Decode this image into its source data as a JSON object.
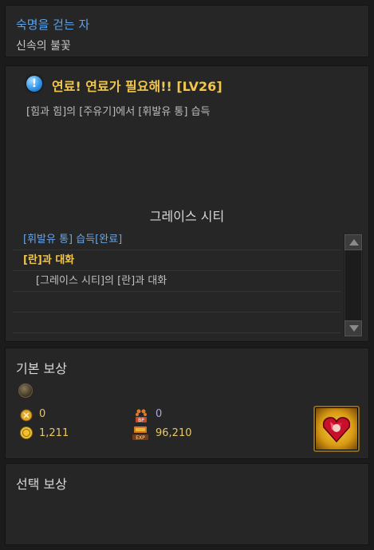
{
  "header": {
    "title": "숙명을 걷는 자",
    "subtitle": "신속의 불꽃"
  },
  "quest": {
    "title": "연료! 연료가 필요해!! [LV26]",
    "description": "[힘과 힘]의 [주유기]에서 [휘발유 통] 습득",
    "location": "그레이스 시티",
    "objectives": [
      {
        "text": "[휘발유 통] 습득[완료]",
        "state": "done"
      },
      {
        "text": "[란]과 대화",
        "state": "active"
      },
      {
        "text": "[그레이스 시티]의 [란]과 대화",
        "state": "sub"
      }
    ]
  },
  "reward": {
    "title": "기본 보상",
    "gold": "0",
    "bp": "0",
    "coins": "1,211",
    "exp": "96,210",
    "item_icon": "heart-gem-icon"
  },
  "select_reward": {
    "title": "선택 보상"
  },
  "colors": {
    "accent_blue": "#5aa3ea",
    "quest_gold": "#f2c64a",
    "done_blue": "#6aa5e6"
  }
}
